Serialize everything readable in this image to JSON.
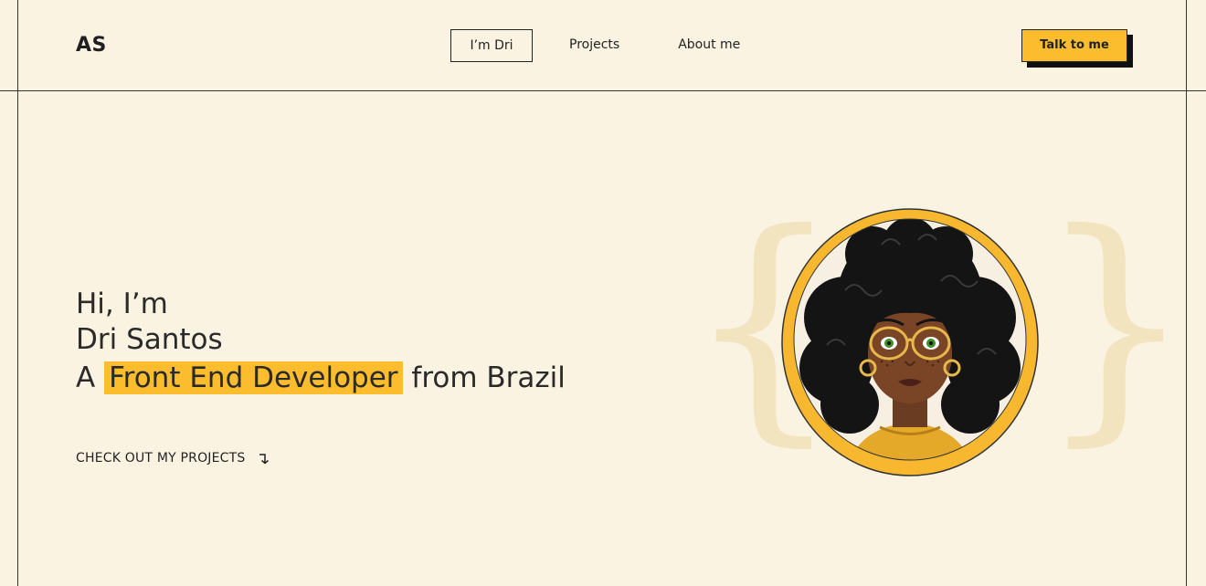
{
  "header": {
    "logo": "AS",
    "nav": [
      {
        "label": "I’m Dri",
        "active": true
      },
      {
        "label": "Projects",
        "active": false
      },
      {
        "label": "About me",
        "active": false
      }
    ],
    "cta_label": "Talk to me"
  },
  "hero": {
    "line1": "Hi, I’m",
    "line2": "Dri Santos",
    "line3_prefix": "A",
    "line3_highlight": "Front End Developer",
    "line3_suffix": "from Brazil",
    "link_label": "CHECK OUT MY PROJECTS"
  },
  "decor": {
    "brace_left": "{",
    "brace_right": "}"
  },
  "colors": {
    "background": "#faf3e2",
    "accent": "#fbbd2e",
    "text": "#222222",
    "brace": "#f3e4c0"
  },
  "icons": {
    "link_arrow": "arrow-down-right-icon",
    "avatar": "illustrated-portrait-avatar"
  }
}
